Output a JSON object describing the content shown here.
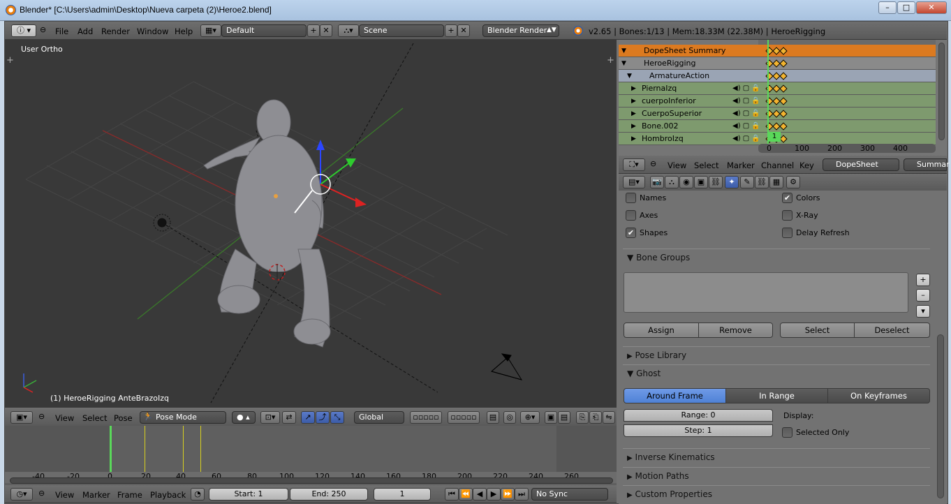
{
  "window": {
    "title": "Blender* [C:\\Users\\admin\\Desktop\\Nueva carpeta (2)\\Heroe2.blend]"
  },
  "topbar": {
    "menus": [
      "File",
      "Add",
      "Render",
      "Window",
      "Help"
    ],
    "layout": "Default",
    "scene": "Scene",
    "engine": "Blender Render",
    "info": "v2.65 | Bones:1/13 | Mem:18.33M (22.38M) | HeroeRigging"
  },
  "viewport": {
    "view_label": "User Ortho",
    "object_label": "(1) HeroeRigging AnteBrazoIzq",
    "header_menus": [
      "View",
      "Select",
      "Pose"
    ],
    "mode": "Pose Mode",
    "orientation": "Global"
  },
  "dopesheet": {
    "channels": [
      {
        "name": "DopeSheet Summary",
        "kind": "summary"
      },
      {
        "name": "HeroeRigging",
        "kind": "object"
      },
      {
        "name": "ArmatureAction",
        "kind": "action"
      },
      {
        "name": "PiernaIzq",
        "kind": "group"
      },
      {
        "name": "cuerpoInferior",
        "kind": "group"
      },
      {
        "name": "CuerpoSuperior",
        "kind": "group"
      },
      {
        "name": "Bone.002",
        "kind": "group"
      },
      {
        "name": "HombroIzq",
        "kind": "group"
      }
    ],
    "ruler": [
      "0",
      "100",
      "200",
      "300",
      "400"
    ],
    "current_frame_badge": "1",
    "header_menus": [
      "View",
      "Select",
      "Marker",
      "Channel",
      "Key"
    ],
    "mode": "DopeSheet",
    "summary_btn": "Summar"
  },
  "properties": {
    "display": [
      {
        "label": "Names",
        "checked": false
      },
      {
        "label": "Colors",
        "checked": true
      },
      {
        "label": "Axes",
        "checked": false
      },
      {
        "label": "X-Ray",
        "checked": false
      },
      {
        "label": "Shapes",
        "checked": true
      },
      {
        "label": "Delay Refresh",
        "checked": false
      }
    ],
    "bone_groups": {
      "title": "Bone Groups",
      "buttons": [
        "Assign",
        "Remove",
        "Select",
        "Deselect"
      ]
    },
    "pose_library": "Pose Library",
    "ghost": {
      "title": "Ghost",
      "tabs": [
        "Around Frame",
        "In Range",
        "On Keyframes"
      ],
      "active_tab": "Around Frame",
      "range": "Range: 0",
      "step": "Step: 1",
      "display_label": "Display:",
      "selected_only": "Selected Only"
    },
    "collapsed_panels": [
      "Inverse Kinematics",
      "Motion Paths",
      "Custom Properties"
    ]
  },
  "timeline": {
    "ruler": [
      "-40",
      "-20",
      "0",
      "20",
      "40",
      "60",
      "80",
      "100",
      "120",
      "140",
      "160",
      "180",
      "200",
      "220",
      "240",
      "260"
    ],
    "header_menus": [
      "View",
      "Marker",
      "Frame",
      "Playback"
    ],
    "start": "Start: 1",
    "end": "End: 250",
    "current": "1",
    "sync": "No Sync"
  },
  "colors": {
    "accent": "#4f82d6",
    "summary_orange": "#dc7a20",
    "playhead": "#58d858"
  }
}
